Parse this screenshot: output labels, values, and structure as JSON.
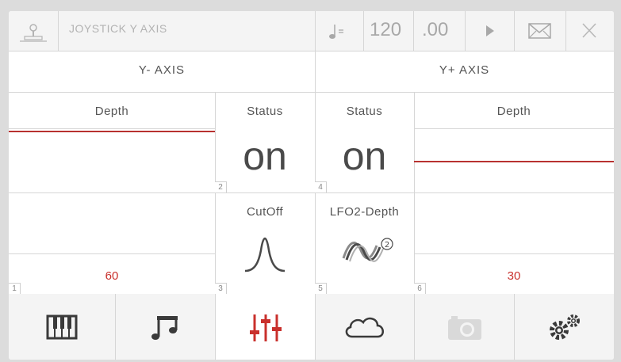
{
  "header": {
    "title": "JOYSTICK Y AXIS",
    "tempo_value": "120",
    "tempo_decimal": ".00",
    "icons": [
      "joystick-icon",
      "metronome-icon",
      "play-icon",
      "mail-icon",
      "close-icon"
    ]
  },
  "axes": {
    "left_label": "Y- AXIS",
    "right_label": "Y+ AXIS"
  },
  "cells": {
    "left_depth": {
      "label": "Depth",
      "value": "60",
      "number": "1"
    },
    "left_status": {
      "label": "Status",
      "value": "on",
      "number": "2"
    },
    "cutoff": {
      "label": "CutOff",
      "number": "3"
    },
    "right_status": {
      "label": "Status",
      "value": "on",
      "number": "4"
    },
    "lfo2": {
      "label": "LFO2-Depth",
      "number": "5"
    },
    "right_depth": {
      "label": "Depth",
      "value": "30",
      "number": "6"
    }
  },
  "tabs": [
    {
      "icon": "piano-icon",
      "active": false
    },
    {
      "icon": "music-note-icon",
      "active": false
    },
    {
      "icon": "mixer-sliders-icon",
      "active": true
    },
    {
      "icon": "cloud-icon",
      "active": false
    },
    {
      "icon": "camera-icon",
      "active": false
    },
    {
      "icon": "gears-icon",
      "active": false
    }
  ],
  "colors": {
    "accent": "#c9302c",
    "background": "#ffffff",
    "bar": "#f4f4f4"
  }
}
